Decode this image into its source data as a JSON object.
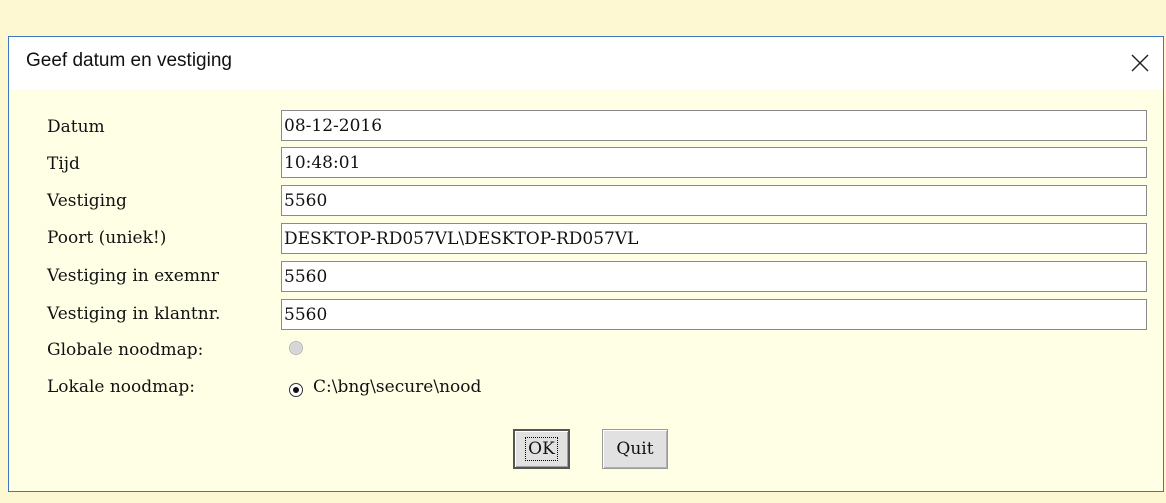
{
  "dialog": {
    "title": "Geef datum en vestiging",
    "close_icon": "close-icon"
  },
  "fields": [
    {
      "label": "Datum",
      "value": "08-12-2016"
    },
    {
      "label": "Tijd",
      "value": "10:48:01"
    },
    {
      "label": "Vestiging",
      "value": "5560"
    },
    {
      "label": "Poort (uniek!)",
      "value": "DESKTOP-RD057VL\\DESKTOP-RD057VL"
    },
    {
      "label": "Vestiging in exemnr",
      "value": "5560"
    },
    {
      "label": "Vestiging in klantnr.",
      "value": "5560"
    }
  ],
  "noodmap": {
    "global_label": "Globale noodmap:",
    "global_enabled": false,
    "local_label": "Lokale noodmap:",
    "local_path": "C:\\bng\\secure\\nood",
    "local_selected": true
  },
  "buttons": {
    "ok_label": "OK",
    "quit_label": "Quit"
  },
  "colors": {
    "dialog_background": "#ffffe6",
    "window_border": "#3f76c4",
    "button_face": "#e1e1e1"
  }
}
